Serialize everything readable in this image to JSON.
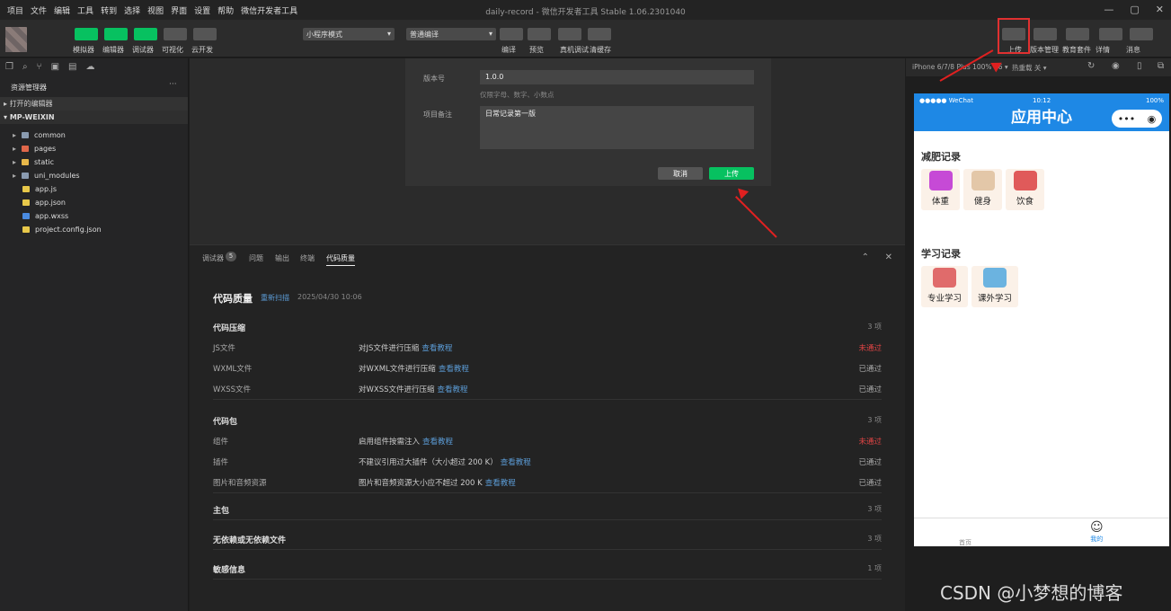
{
  "menu": [
    "项目",
    "文件",
    "编辑",
    "工具",
    "转到",
    "选择",
    "视图",
    "界面",
    "设置",
    "帮助",
    "微信开发者工具"
  ],
  "title": "daily-record - 微信开发者工具 Stable 1.06.2301040",
  "toolbar": {
    "left_buttons": [
      {
        "label": "模拟器"
      },
      {
        "label": "编辑器"
      },
      {
        "label": "调试器"
      },
      {
        "label": "可视化"
      },
      {
        "label": "云开发"
      }
    ],
    "mode_select": "小程序模式",
    "compile_select": "普通编译",
    "mid_buttons": [
      {
        "label": "编译"
      },
      {
        "label": "预览"
      },
      {
        "label": "真机调试"
      },
      {
        "label": "清缓存"
      }
    ],
    "right_buttons": [
      {
        "label": "上传"
      },
      {
        "label": "版本管理"
      },
      {
        "label": "教育套件"
      },
      {
        "label": "详情"
      },
      {
        "label": "消息"
      }
    ]
  },
  "sidebar": {
    "title": "资源管理器",
    "open_editors": "打开的编辑器",
    "project": "MP-WEIXIN",
    "folders": [
      {
        "name": "common",
        "color": "#8a9bb0"
      },
      {
        "name": "pages",
        "color": "#e0674a"
      },
      {
        "name": "static",
        "color": "#e8b84a"
      },
      {
        "name": "uni_modules",
        "color": "#8a9bb0"
      }
    ],
    "files": [
      {
        "name": "app.js",
        "color": "#e8c84a",
        "glyph": "JS"
      },
      {
        "name": "app.json",
        "color": "#e8c84a",
        "glyph": "{}"
      },
      {
        "name": "app.wxss",
        "color": "#4a8be0",
        "glyph": "#"
      },
      {
        "name": "project.config.json",
        "color": "#e8c84a",
        "glyph": "{}"
      }
    ]
  },
  "dialog": {
    "version_label": "版本号",
    "version_value": "1.0.0",
    "version_hint": "仅限字母、数字、小数点",
    "remark_label": "项目备注",
    "remark_value": "日常记录第一版",
    "cancel": "取消",
    "upload": "上传"
  },
  "panel": {
    "tabs": [
      "调试器",
      "问题",
      "输出",
      "终端",
      "代码质量"
    ],
    "debugger_badge": "5",
    "heading": "代码质量",
    "rescan": "重新扫描",
    "date": "2025/04/30 10:06",
    "sections": [
      {
        "title": "代码压缩",
        "count": "3 项",
        "rows": [
          {
            "name": "JS文件",
            "desc": "对JS文件进行压缩",
            "link": "查看教程",
            "status": "未通过",
            "fail": true
          },
          {
            "name": "WXML文件",
            "desc": "对WXML文件进行压缩",
            "link": "查看教程",
            "status": "已通过",
            "fail": false
          },
          {
            "name": "WXSS文件",
            "desc": "对WXSS文件进行压缩",
            "link": "查看教程",
            "status": "已通过",
            "fail": false
          }
        ]
      },
      {
        "title": "代码包",
        "count": "3 项",
        "rows": [
          {
            "name": "组件",
            "desc": "启用组件按需注入",
            "link": "查看教程",
            "status": "未通过",
            "fail": true
          },
          {
            "name": "插件",
            "desc": "不建议引用过大插件（大小超过 200 K）",
            "link": "查看教程",
            "status": "已通过",
            "fail": false
          },
          {
            "name": "图片和音频资源",
            "desc": "图片和音频资源大小应不超过 200 K",
            "link": "查看教程",
            "status": "已通过",
            "fail": false
          }
        ]
      }
    ],
    "collapsed": [
      {
        "title": "主包",
        "count": "3 项"
      },
      {
        "title": "无依赖或无依赖文件",
        "count": "3 项"
      },
      {
        "title": "敏感信息",
        "count": "1 项"
      }
    ]
  },
  "simulator": {
    "device": "iPhone 6/7/8 Plus 100% 16 ▾",
    "hotreload": "热重载 关 ▾",
    "carrier": "●●●●● WeChat",
    "time": "10:12",
    "battery": "100%",
    "nav_title": "应用中心",
    "sections": [
      {
        "title": "减肥记录",
        "items": [
          {
            "label": "体重",
            "color": "#c64ad6"
          },
          {
            "label": "健身",
            "color": "#e3c7a8"
          },
          {
            "label": "饮食",
            "color": "#e05a5a"
          }
        ]
      },
      {
        "title": "学习记录",
        "items": [
          {
            "label": "专业学习",
            "color": "#e06b6b"
          },
          {
            "label": "课外学习",
            "color": "#6bb3e0"
          }
        ]
      }
    ],
    "tabs": [
      {
        "label": "首页",
        "active": false
      },
      {
        "label": "我的",
        "active": true
      }
    ]
  },
  "watermark": "CSDN @小梦想的博客",
  "colors": {
    "accent": "#07c160",
    "highlight": "#e03030",
    "nav": "#1e88e5"
  }
}
